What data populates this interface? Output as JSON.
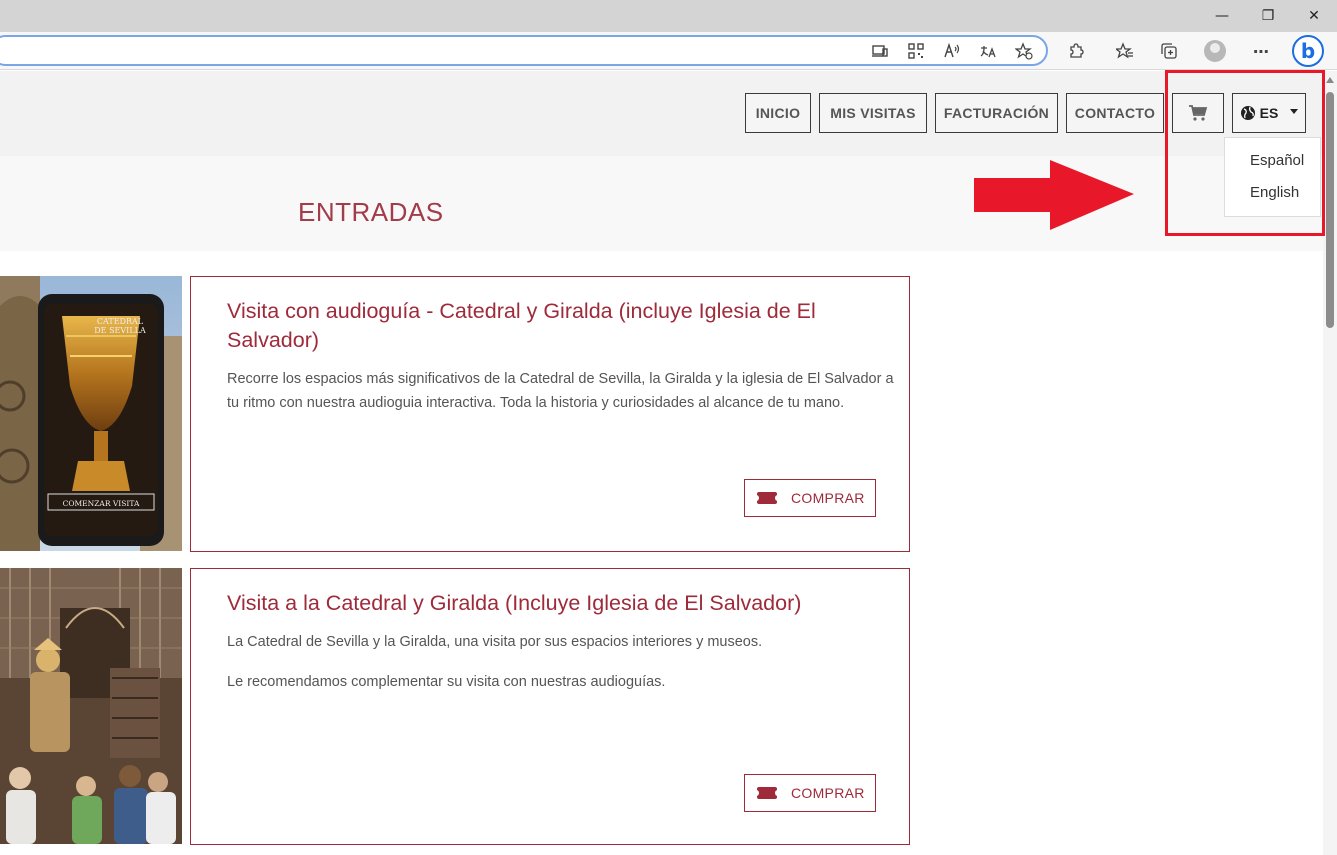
{
  "nav": {
    "items": [
      {
        "label": "INICIO"
      },
      {
        "label": "MIS VISITAS"
      },
      {
        "label": "FACTURACIÓN"
      },
      {
        "label": "CONTACTO"
      }
    ],
    "cart_icon": "cart-icon",
    "language": {
      "current": "ES",
      "icon": "globe-icon",
      "options": [
        "Español",
        "English"
      ]
    }
  },
  "banner": {
    "title": "ENTRADAS"
  },
  "cards": [
    {
      "title": "Visita con audioguía - Catedral y Giralda (incluye Iglesia de El Salvador)",
      "paragraphs": [
        "Recorre los espacios más significativos de la Catedral de Sevilla, la Giralda y la iglesia de El Salvador a tu ritmo con nuestra audioguia interactiva. Toda la historia y curiosidades al alcance de tu mano."
      ],
      "image_text": {
        "brand_line1": "CATEDRAL",
        "brand_line2": "DE SEVILLA",
        "button": "COMENZAR VISITA"
      },
      "button_label": "COMPRAR"
    },
    {
      "title": "Visita a la Catedral y Giralda (Incluye Iglesia de El Salvador)",
      "paragraphs": [
        "La Catedral de Sevilla y la Giralda, una visita por sus espacios interiores y museos.",
        "Le recomendamos complementar su visita con nuestras audioguías."
      ],
      "button_label": "COMPRAR"
    }
  ],
  "colors": {
    "brand": "#9e2a3a",
    "annotation": "#e8182a",
    "accent_browser": "#1b6de0"
  }
}
